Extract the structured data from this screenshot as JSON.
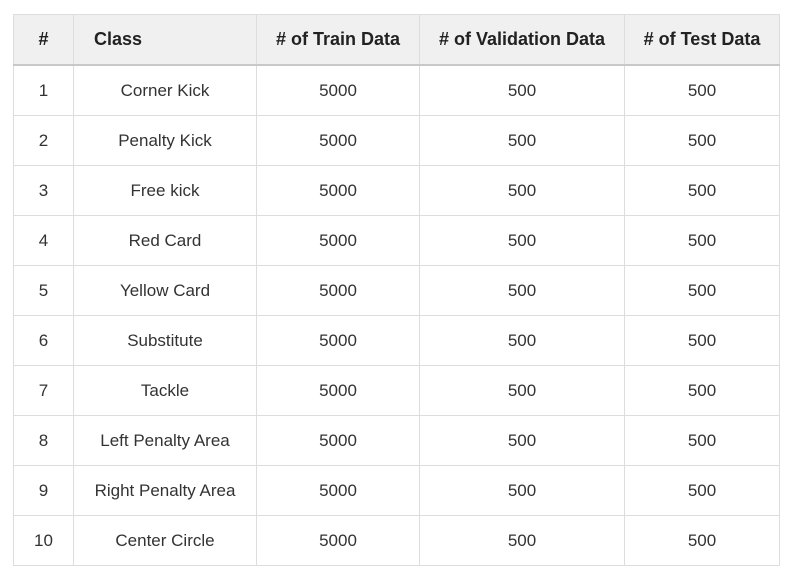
{
  "table": {
    "headers": [
      "#",
      "Class",
      "# of Train Data",
      "# of Validation Data",
      "# of Test Data"
    ],
    "rows": [
      [
        "1",
        "Corner Kick",
        "5000",
        "500",
        "500"
      ],
      [
        "2",
        "Penalty Kick",
        "5000",
        "500",
        "500"
      ],
      [
        "3",
        "Free kick",
        "5000",
        "500",
        "500"
      ],
      [
        "4",
        "Red Card",
        "5000",
        "500",
        "500"
      ],
      [
        "5",
        "Yellow Card",
        "5000",
        "500",
        "500"
      ],
      [
        "6",
        "Substitute",
        "5000",
        "500",
        "500"
      ],
      [
        "7",
        "Tackle",
        "5000",
        "500",
        "500"
      ],
      [
        "8",
        "Left Penalty Area",
        "5000",
        "500",
        "500"
      ],
      [
        "9",
        "Right Penalty Area",
        "5000",
        "500",
        "500"
      ],
      [
        "10",
        "Center Circle",
        "5000",
        "500",
        "500"
      ]
    ]
  },
  "colors": {
    "header_bg": "#f0f0f0",
    "border": "#dddddd",
    "text": "#333333"
  }
}
